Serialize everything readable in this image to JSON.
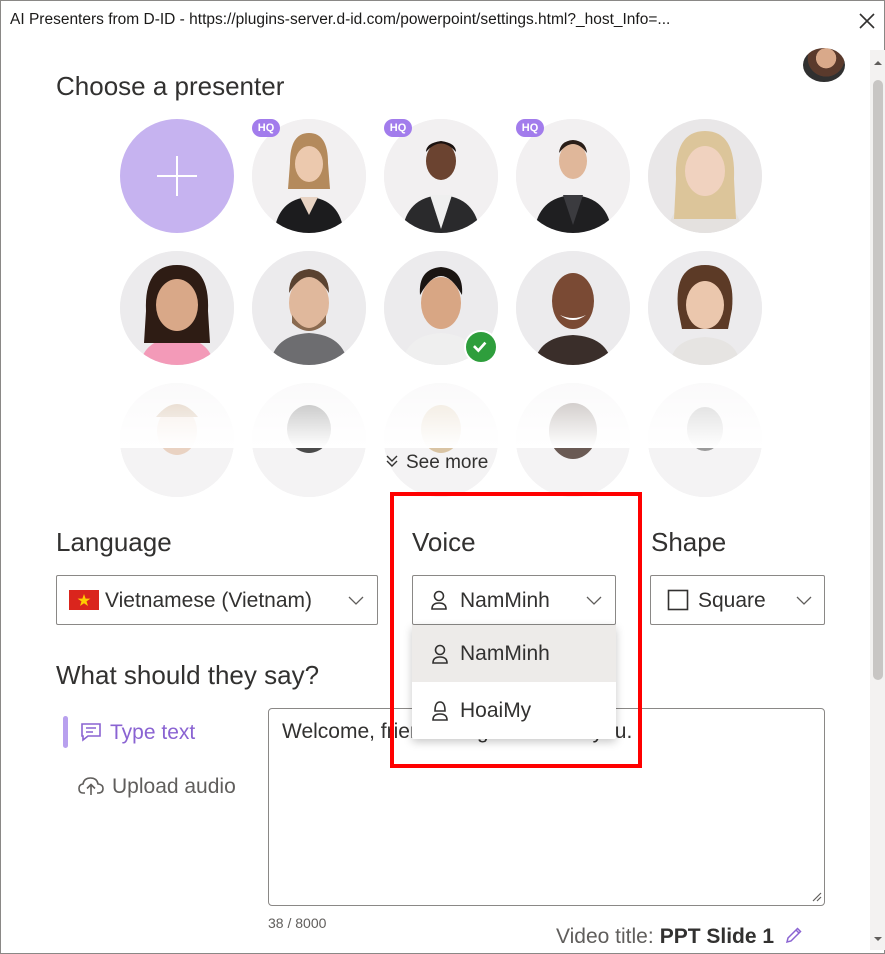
{
  "window": {
    "title": "AI Presenters from D-ID - https://plugins-server.d-id.com/powerpoint/settings.html?_host_Info=...",
    "close_icon": "close-icon"
  },
  "presenters": {
    "heading": "Choose a presenter",
    "hq_badge": "HQ",
    "see_more": "See more",
    "selected_index": 7
  },
  "language": {
    "label": "Language",
    "value": "Vietnamese (Vietnam)",
    "flag": "vietnam-flag-icon"
  },
  "voice": {
    "label": "Voice",
    "value": "NamMinh",
    "options": [
      "NamMinh",
      "HoaiMy"
    ]
  },
  "shape": {
    "label": "Shape",
    "value": "Square"
  },
  "script": {
    "heading": "What should they say?",
    "modes": [
      "Type text",
      "Upload audio"
    ],
    "text": "Welcome, friend. It's good to see you.",
    "char_count": "38 / 8000"
  },
  "video": {
    "title_label": "Video title:",
    "title_value": "PPT Slide 1"
  },
  "colors": {
    "accent": "#a27cec",
    "add_button": "#c6b3f0",
    "selected_check": "#2e9e3c",
    "highlight": "#ff0000"
  }
}
